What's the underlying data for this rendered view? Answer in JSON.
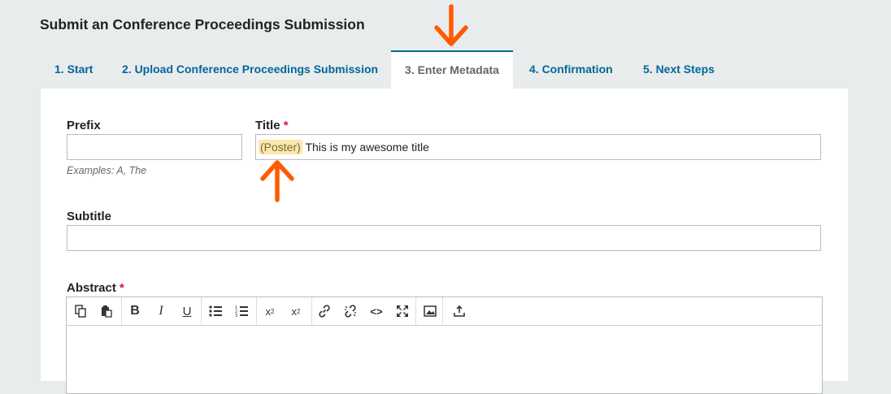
{
  "page": {
    "title": "Submit an Conference Proceedings Submission"
  },
  "tabs": [
    {
      "label": "1. Start"
    },
    {
      "label": "2. Upload Conference Proceedings Submission"
    },
    {
      "label": "3. Enter Metadata"
    },
    {
      "label": "4. Confirmation"
    },
    {
      "label": "5. Next Steps"
    }
  ],
  "form": {
    "prefix": {
      "label": "Prefix",
      "value": "",
      "help": "Examples: A, The"
    },
    "title": {
      "label": "Title",
      "required_mark": "*",
      "prefix_tag": "(Poster)",
      "value": "This is my awesome title"
    },
    "subtitle": {
      "label": "Subtitle",
      "value": ""
    },
    "abstract": {
      "label": "Abstract",
      "required_mark": "*"
    }
  },
  "toolbar": {
    "buttons": [
      "copy-icon",
      "paste-icon",
      "bold-icon",
      "italic-icon",
      "underline-icon",
      "bullet-list-icon",
      "numbered-list-icon",
      "superscript-icon",
      "subscript-icon",
      "link-icon",
      "unlink-icon",
      "code-icon",
      "fullscreen-icon",
      "image-icon",
      "upload-icon"
    ]
  },
  "colors": {
    "accent": "#006798",
    "annotation_arrow": "#ff5a00",
    "required": "#d00a6c"
  }
}
